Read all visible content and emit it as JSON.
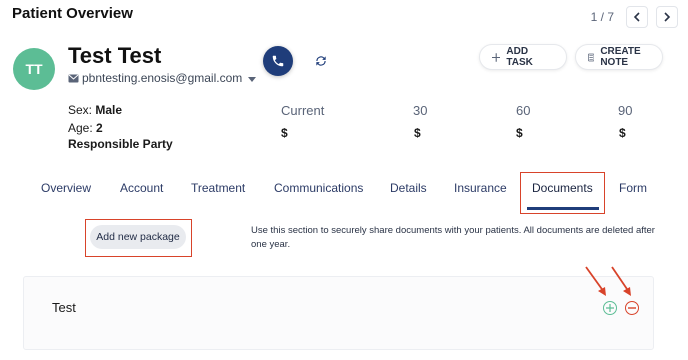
{
  "header": {
    "title": "Patient Overview",
    "pager_text": "1 / 7"
  },
  "patient": {
    "initials": "TT",
    "name": "Test Test",
    "email": "pbntesting.enosis@gmail.com",
    "sex_label": "Sex:",
    "sex": "Male",
    "age_label": "Age:",
    "age": "2",
    "responsible_party": "Responsible Party"
  },
  "actions": {
    "add_task": "ADD TASK",
    "create_note": "CREATE NOTE"
  },
  "balances": {
    "headers": [
      "Current",
      "30",
      "60",
      "90"
    ],
    "values": [
      "$",
      "$",
      "$",
      "$"
    ]
  },
  "tabs": [
    "Overview",
    "Account",
    "Treatment",
    "Communications",
    "Details",
    "Insurance",
    "Documents",
    "Form"
  ],
  "active_tab": "Documents",
  "documents": {
    "add_package_label": "Add new package",
    "description": "Use this section to securely share documents with your patients. All documents are deleted after one year.",
    "packages": [
      {
        "name": "Test"
      }
    ]
  },
  "colors": {
    "accent": "#1f3d7a",
    "avatar": "#5cbd95",
    "annotation": "#d8432a",
    "remove": "#d8432a",
    "add": "#5cbd95"
  },
  "icons": [
    "chevron-left-icon",
    "chevron-right-icon",
    "mail-icon",
    "phone-icon",
    "refresh-icon",
    "plus-icon",
    "note-icon",
    "add-circle-icon",
    "remove-circle-icon"
  ]
}
